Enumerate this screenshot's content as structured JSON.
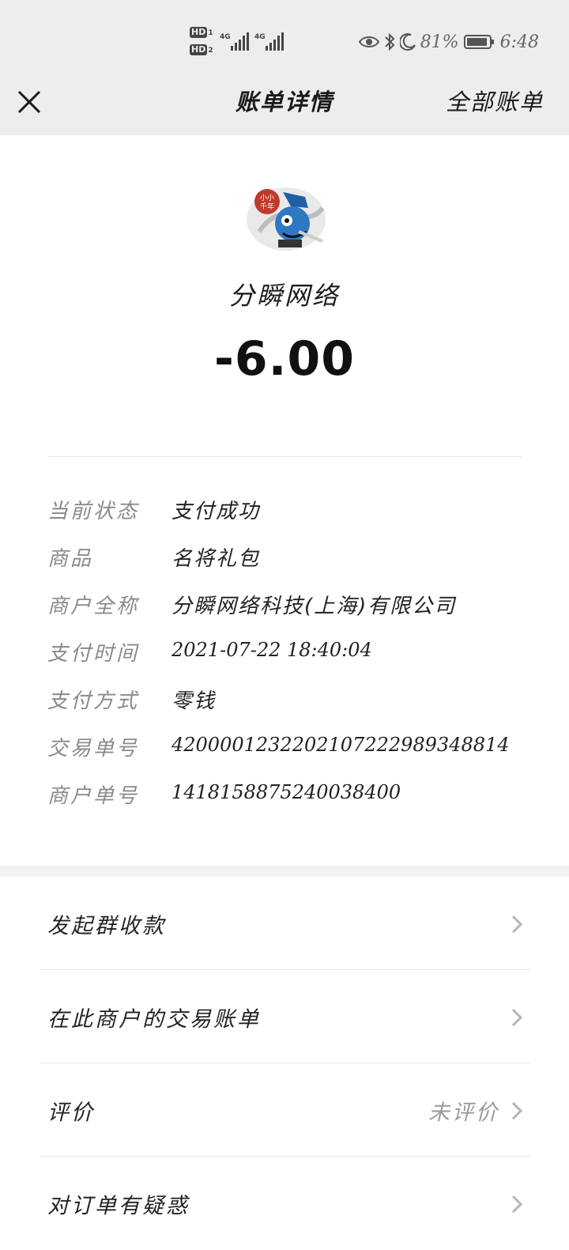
{
  "status_bar": {
    "hd1": "HD",
    "hd1_num": "1",
    "hd2": "HD",
    "hd2_num": "2",
    "net1": "4G",
    "net2": "4G",
    "battery_percent": "81%",
    "time": "6:48",
    "icons": [
      "eye-icon",
      "bluetooth-icon",
      "moon-icon",
      "battery-icon"
    ]
  },
  "nav": {
    "close_icon": "close-icon",
    "title": "账单详情",
    "all_bills": "全部账单"
  },
  "header": {
    "merchant_name": "分瞬网络",
    "amount": "-6.00",
    "avatar_text": "小小千年"
  },
  "details": [
    {
      "label": "当前状态",
      "value": "支付成功"
    },
    {
      "label": "商品",
      "value": "名将礼包"
    },
    {
      "label": "商户全称",
      "value": "分瞬网络科技(上海)有限公司"
    },
    {
      "label": "支付时间",
      "value": "2021-07-22 18:40:04"
    },
    {
      "label": "支付方式",
      "value": "零钱"
    },
    {
      "label": "交易单号",
      "value": "4200001232202107222989348814"
    },
    {
      "label": "商户单号",
      "value": "1418158875240038400"
    }
  ],
  "actions": [
    {
      "label": "发起群收款",
      "value": ""
    },
    {
      "label": "在此商户的交易账单",
      "value": ""
    },
    {
      "label": "评价",
      "value": "未评价"
    },
    {
      "label": "对订单有疑惑",
      "value": ""
    }
  ],
  "colors": {
    "nav_bg": "#ededed",
    "label_gray": "#8a8a8a",
    "text_dark": "#1a1a1a"
  }
}
